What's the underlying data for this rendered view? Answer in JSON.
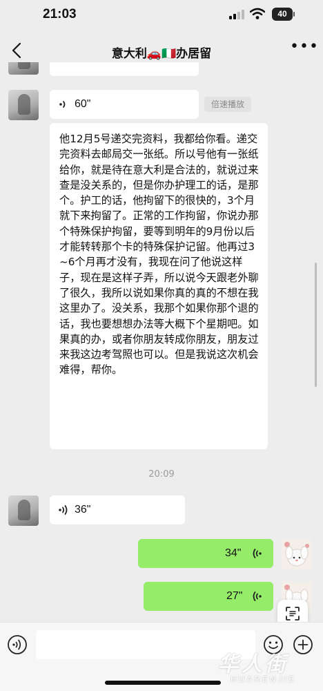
{
  "status_bar": {
    "time": "21:03",
    "battery": "40"
  },
  "nav": {
    "title": "意大利🚗🇮🇹办居留"
  },
  "messages": [
    {
      "side": "left",
      "type": "partial-bubble"
    },
    {
      "side": "left",
      "type": "voice",
      "duration": "60\"",
      "speed_label": "倍速播放",
      "transcript": "他12月5号递交完资料，我都给你看。递交完资料去邮局交一张纸。所以号他有一张纸给你，就是待在意大利是合法的，就说过来查是没关系的，但是你办护理工的话，是那个。护工的话，他拘留下的很快的，3个月就下来拘留了。正常的工作拘留，你说办那个特殊保护拘留，要等到明年的9月份以后才能转转那个卡的特殊保护记留。他再过3~6个月再才没有，我现在问了他说这样子，现在是这样子弄，所以说今天跟老外聊了很久，我所以说如果你真的真的不想在我这里办了。没关系，我那个如果你那个退的话，我也要想想办法等大概下个星期吧。如果真的办，或者你朋友转成你朋友，朋友过来我这边考驾照也可以。但是我说这次机会难得，帮你。"
    },
    {
      "type": "timestamp",
      "text": "20:09"
    },
    {
      "side": "left",
      "type": "voice",
      "duration": "36\""
    },
    {
      "side": "right",
      "type": "voice",
      "duration": "34\""
    },
    {
      "side": "right",
      "type": "voice",
      "duration": "27\""
    }
  ],
  "input_bar": {
    "placeholder": ""
  },
  "watermark": {
    "main": "华人街",
    "sub": "HUARENJIE"
  },
  "icons": {
    "back": "chevron-left-icon",
    "more": "more-dots-icon",
    "voice_toggle": "voice-icon",
    "emoji": "emoji-icon",
    "plus": "plus-icon",
    "float": "text-scan-icon"
  },
  "colors": {
    "background": "#ededed",
    "bubble_incoming": "#ffffff",
    "bubble_outgoing": "#95ec69"
  }
}
